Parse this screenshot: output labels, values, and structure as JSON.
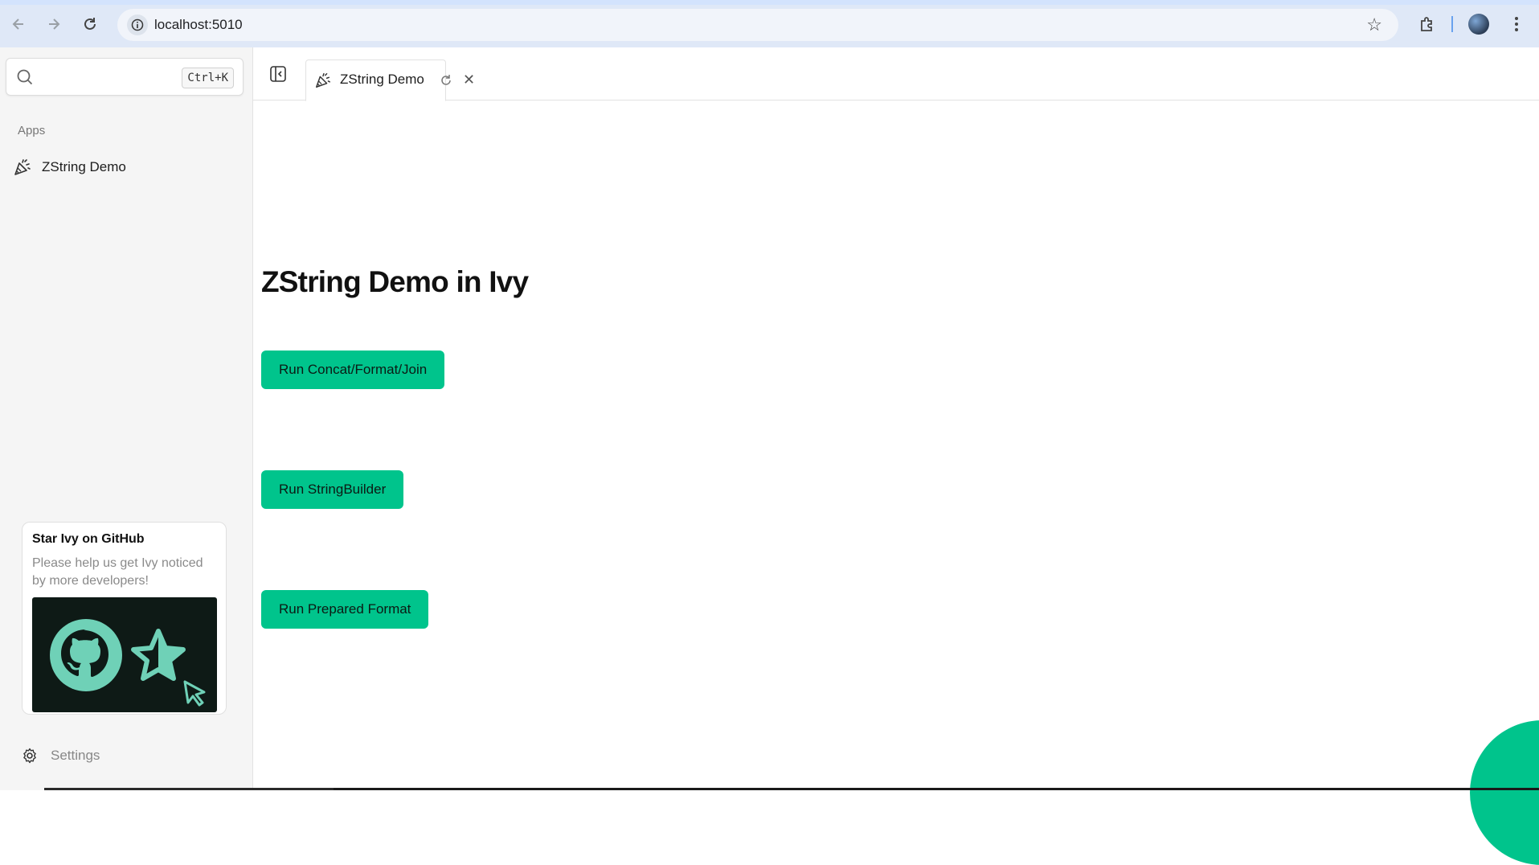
{
  "browser": {
    "url": "localhost:5010",
    "back_icon": "arrow-left-icon",
    "forward_icon": "arrow-right-icon",
    "reload_icon": "reload-icon"
  },
  "sidebar": {
    "search": {
      "placeholder": "",
      "shortcut": "Ctrl+K"
    },
    "section_label": "Apps",
    "items": [
      {
        "label": "ZString Demo",
        "icon": "party-popper-icon"
      }
    ],
    "github_card": {
      "title": "Star Ivy on GitHub",
      "description": "Please help us get Ivy noticed by more developers!"
    },
    "settings_label": "Settings"
  },
  "tabs": [
    {
      "label": "ZString Demo",
      "icon": "party-popper-icon"
    }
  ],
  "main": {
    "title": "ZString Demo in Ivy",
    "buttons": [
      {
        "label": "Run Concat/Format/Join"
      },
      {
        "label": "Run StringBuilder"
      },
      {
        "label": "Run Prepared Format"
      }
    ]
  },
  "colors": {
    "accent": "#00c48c",
    "sidebar_bg": "#f5f5f5",
    "browser_toolbar": "#dfe8f7"
  }
}
